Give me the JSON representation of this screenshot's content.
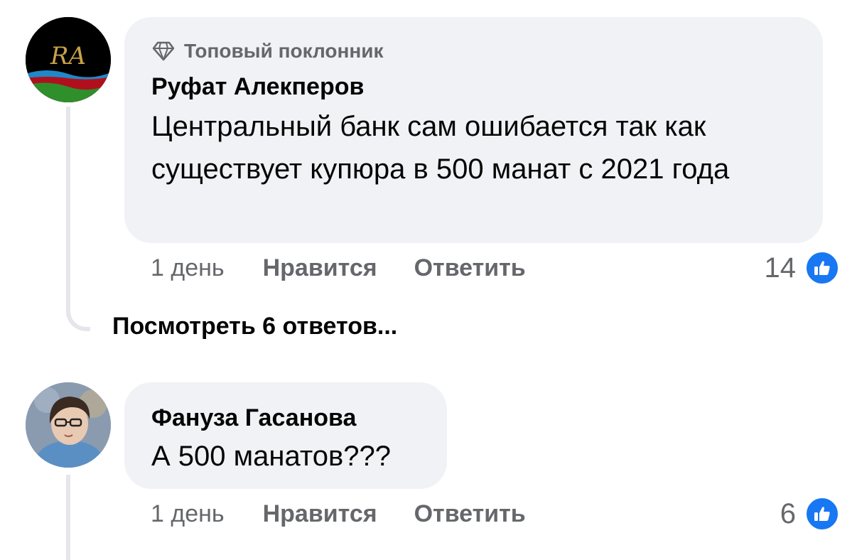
{
  "comments": [
    {
      "badge": "Топовый поклонник",
      "author": "Руфат Алекперов",
      "text": "Центральный банк сам ошибается так как существует купюра в 500 манат с 2021 года",
      "time": "1 день",
      "like_label": "Нравится",
      "reply_label": "Ответить",
      "reaction_count": "14",
      "avatar_initials": "RA",
      "view_replies": "Посмотреть 6 ответов..."
    },
    {
      "author": "Фануза Гасанова",
      "text": "А 500 манатов???",
      "time": "1 день",
      "like_label": "Нравится",
      "reply_label": "Ответить",
      "reaction_count": "6"
    }
  ],
  "colors": {
    "bubble": "#f0f2f5",
    "secondary_text": "#65676b",
    "like_blue": "#1877f2",
    "thread_line": "#e4e6eb"
  },
  "icons": [
    "diamond-icon",
    "thumbs-up-icon"
  ]
}
